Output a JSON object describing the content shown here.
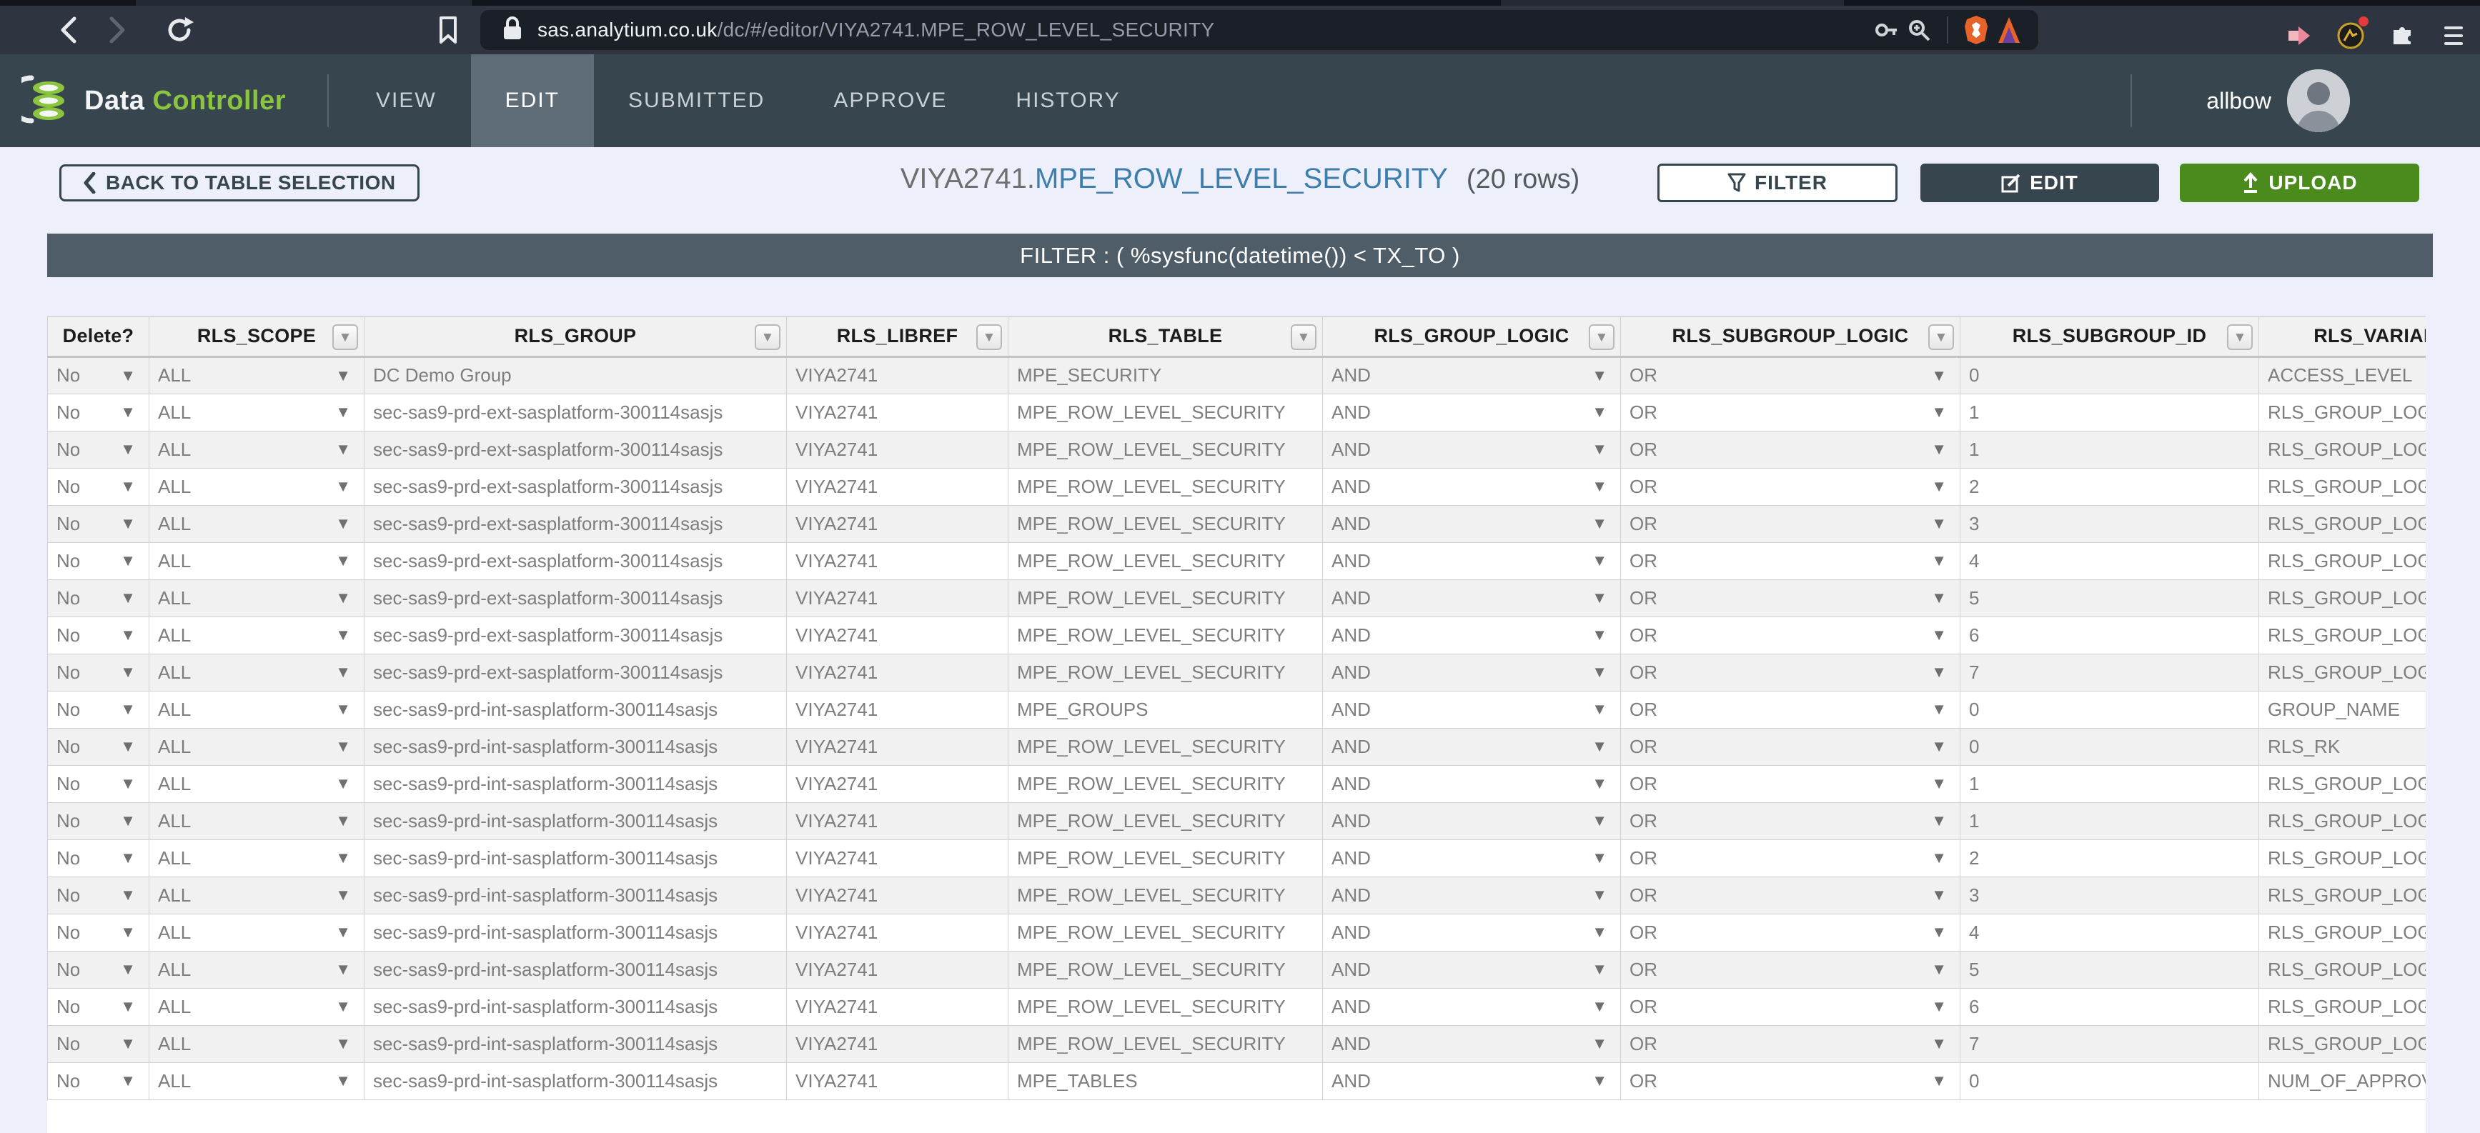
{
  "browser": {
    "url_domain": "sas.analytium.co.uk",
    "url_path": "/dc/#/editor/VIYA2741.MPE_ROW_LEVEL_SECURITY"
  },
  "nav": {
    "brand_primary": "Data",
    "brand_secondary": "Controller",
    "tabs": [
      {
        "label": "VIEW",
        "active": false
      },
      {
        "label": "EDIT",
        "active": true
      },
      {
        "label": "SUBMITTED",
        "active": false
      },
      {
        "label": "APPROVE",
        "active": false
      },
      {
        "label": "HISTORY",
        "active": false
      }
    ],
    "username": "allbow"
  },
  "toolbar": {
    "back_label": "BACK TO TABLE SELECTION",
    "title_lib": "VIYA2741.",
    "title_table": "MPE_ROW_LEVEL_SECURITY",
    "row_count": "(20 rows)",
    "filter_label": "FILTER",
    "edit_label": "EDIT",
    "upload_label": "UPLOAD"
  },
  "filter_banner": "FILTER : ( %sysfunc(datetime()) < TX_TO )",
  "table": {
    "columns": [
      {
        "label": "Delete?",
        "filter": false,
        "type": "select"
      },
      {
        "label": "RLS_SCOPE",
        "filter": true,
        "type": "select"
      },
      {
        "label": "RLS_GROUP",
        "filter": true,
        "type": "text"
      },
      {
        "label": "RLS_LIBREF",
        "filter": true,
        "type": "text"
      },
      {
        "label": "RLS_TABLE",
        "filter": true,
        "type": "text"
      },
      {
        "label": "RLS_GROUP_LOGIC",
        "filter": true,
        "type": "select"
      },
      {
        "label": "RLS_SUBGROUP_LOGIC",
        "filter": true,
        "type": "select"
      },
      {
        "label": "RLS_SUBGROUP_ID",
        "filter": true,
        "type": "text"
      },
      {
        "label": "RLS_VARIABLE_NM",
        "filter": true,
        "type": "text"
      }
    ],
    "rows": [
      [
        "No",
        "ALL",
        "DC Demo Group",
        "VIYA2741",
        "MPE_SECURITY",
        "AND",
        "OR",
        "0",
        "ACCESS_LEVEL"
      ],
      [
        "No",
        "ALL",
        "sec-sas9-prd-ext-sasplatform-300114sasjs",
        "VIYA2741",
        "MPE_ROW_LEVEL_SECURITY",
        "AND",
        "OR",
        "1",
        "RLS_GROUP_LOGIC"
      ],
      [
        "No",
        "ALL",
        "sec-sas9-prd-ext-sasplatform-300114sasjs",
        "VIYA2741",
        "MPE_ROW_LEVEL_SECURITY",
        "AND",
        "OR",
        "1",
        "RLS_GROUP_LOGIC"
      ],
      [
        "No",
        "ALL",
        "sec-sas9-prd-ext-sasplatform-300114sasjs",
        "VIYA2741",
        "MPE_ROW_LEVEL_SECURITY",
        "AND",
        "OR",
        "2",
        "RLS_GROUP_LOGIC"
      ],
      [
        "No",
        "ALL",
        "sec-sas9-prd-ext-sasplatform-300114sasjs",
        "VIYA2741",
        "MPE_ROW_LEVEL_SECURITY",
        "AND",
        "OR",
        "3",
        "RLS_GROUP_LOGIC"
      ],
      [
        "No",
        "ALL",
        "sec-sas9-prd-ext-sasplatform-300114sasjs",
        "VIYA2741",
        "MPE_ROW_LEVEL_SECURITY",
        "AND",
        "OR",
        "4",
        "RLS_GROUP_LOGIC"
      ],
      [
        "No",
        "ALL",
        "sec-sas9-prd-ext-sasplatform-300114sasjs",
        "VIYA2741",
        "MPE_ROW_LEVEL_SECURITY",
        "AND",
        "OR",
        "5",
        "RLS_GROUP_LOGIC"
      ],
      [
        "No",
        "ALL",
        "sec-sas9-prd-ext-sasplatform-300114sasjs",
        "VIYA2741",
        "MPE_ROW_LEVEL_SECURITY",
        "AND",
        "OR",
        "6",
        "RLS_GROUP_LOGIC"
      ],
      [
        "No",
        "ALL",
        "sec-sas9-prd-ext-sasplatform-300114sasjs",
        "VIYA2741",
        "MPE_ROW_LEVEL_SECURITY",
        "AND",
        "OR",
        "7",
        "RLS_GROUP_LOGIC"
      ],
      [
        "No",
        "ALL",
        "sec-sas9-prd-int-sasplatform-300114sasjs",
        "VIYA2741",
        "MPE_GROUPS",
        "AND",
        "OR",
        "0",
        "GROUP_NAME"
      ],
      [
        "No",
        "ALL",
        "sec-sas9-prd-int-sasplatform-300114sasjs",
        "VIYA2741",
        "MPE_ROW_LEVEL_SECURITY",
        "AND",
        "OR",
        "0",
        "RLS_RK"
      ],
      [
        "No",
        "ALL",
        "sec-sas9-prd-int-sasplatform-300114sasjs",
        "VIYA2741",
        "MPE_ROW_LEVEL_SECURITY",
        "AND",
        "OR",
        "1",
        "RLS_GROUP_LOGIC"
      ],
      [
        "No",
        "ALL",
        "sec-sas9-prd-int-sasplatform-300114sasjs",
        "VIYA2741",
        "MPE_ROW_LEVEL_SECURITY",
        "AND",
        "OR",
        "1",
        "RLS_GROUP_LOGIC"
      ],
      [
        "No",
        "ALL",
        "sec-sas9-prd-int-sasplatform-300114sasjs",
        "VIYA2741",
        "MPE_ROW_LEVEL_SECURITY",
        "AND",
        "OR",
        "2",
        "RLS_GROUP_LOGIC"
      ],
      [
        "No",
        "ALL",
        "sec-sas9-prd-int-sasplatform-300114sasjs",
        "VIYA2741",
        "MPE_ROW_LEVEL_SECURITY",
        "AND",
        "OR",
        "3",
        "RLS_GROUP_LOGIC"
      ],
      [
        "No",
        "ALL",
        "sec-sas9-prd-int-sasplatform-300114sasjs",
        "VIYA2741",
        "MPE_ROW_LEVEL_SECURITY",
        "AND",
        "OR",
        "4",
        "RLS_GROUP_LOGIC"
      ],
      [
        "No",
        "ALL",
        "sec-sas9-prd-int-sasplatform-300114sasjs",
        "VIYA2741",
        "MPE_ROW_LEVEL_SECURITY",
        "AND",
        "OR",
        "5",
        "RLS_GROUP_LOGIC"
      ],
      [
        "No",
        "ALL",
        "sec-sas9-prd-int-sasplatform-300114sasjs",
        "VIYA2741",
        "MPE_ROW_LEVEL_SECURITY",
        "AND",
        "OR",
        "6",
        "RLS_GROUP_LOGIC"
      ],
      [
        "No",
        "ALL",
        "sec-sas9-prd-int-sasplatform-300114sasjs",
        "VIYA2741",
        "MPE_ROW_LEVEL_SECURITY",
        "AND",
        "OR",
        "7",
        "RLS_GROUP_LOGIC"
      ],
      [
        "No",
        "ALL",
        "sec-sas9-prd-int-sasplatform-300114sasjs",
        "VIYA2741",
        "MPE_TABLES",
        "AND",
        "OR",
        "0",
        "NUM_OF_APPROVALS"
      ]
    ]
  },
  "colors": {
    "accent_green": "#8bc53f",
    "upload_green": "#4b8b1d",
    "slate": "#36454e",
    "title_blue": "#3d7ead",
    "filterbar": "#4e5d67"
  }
}
